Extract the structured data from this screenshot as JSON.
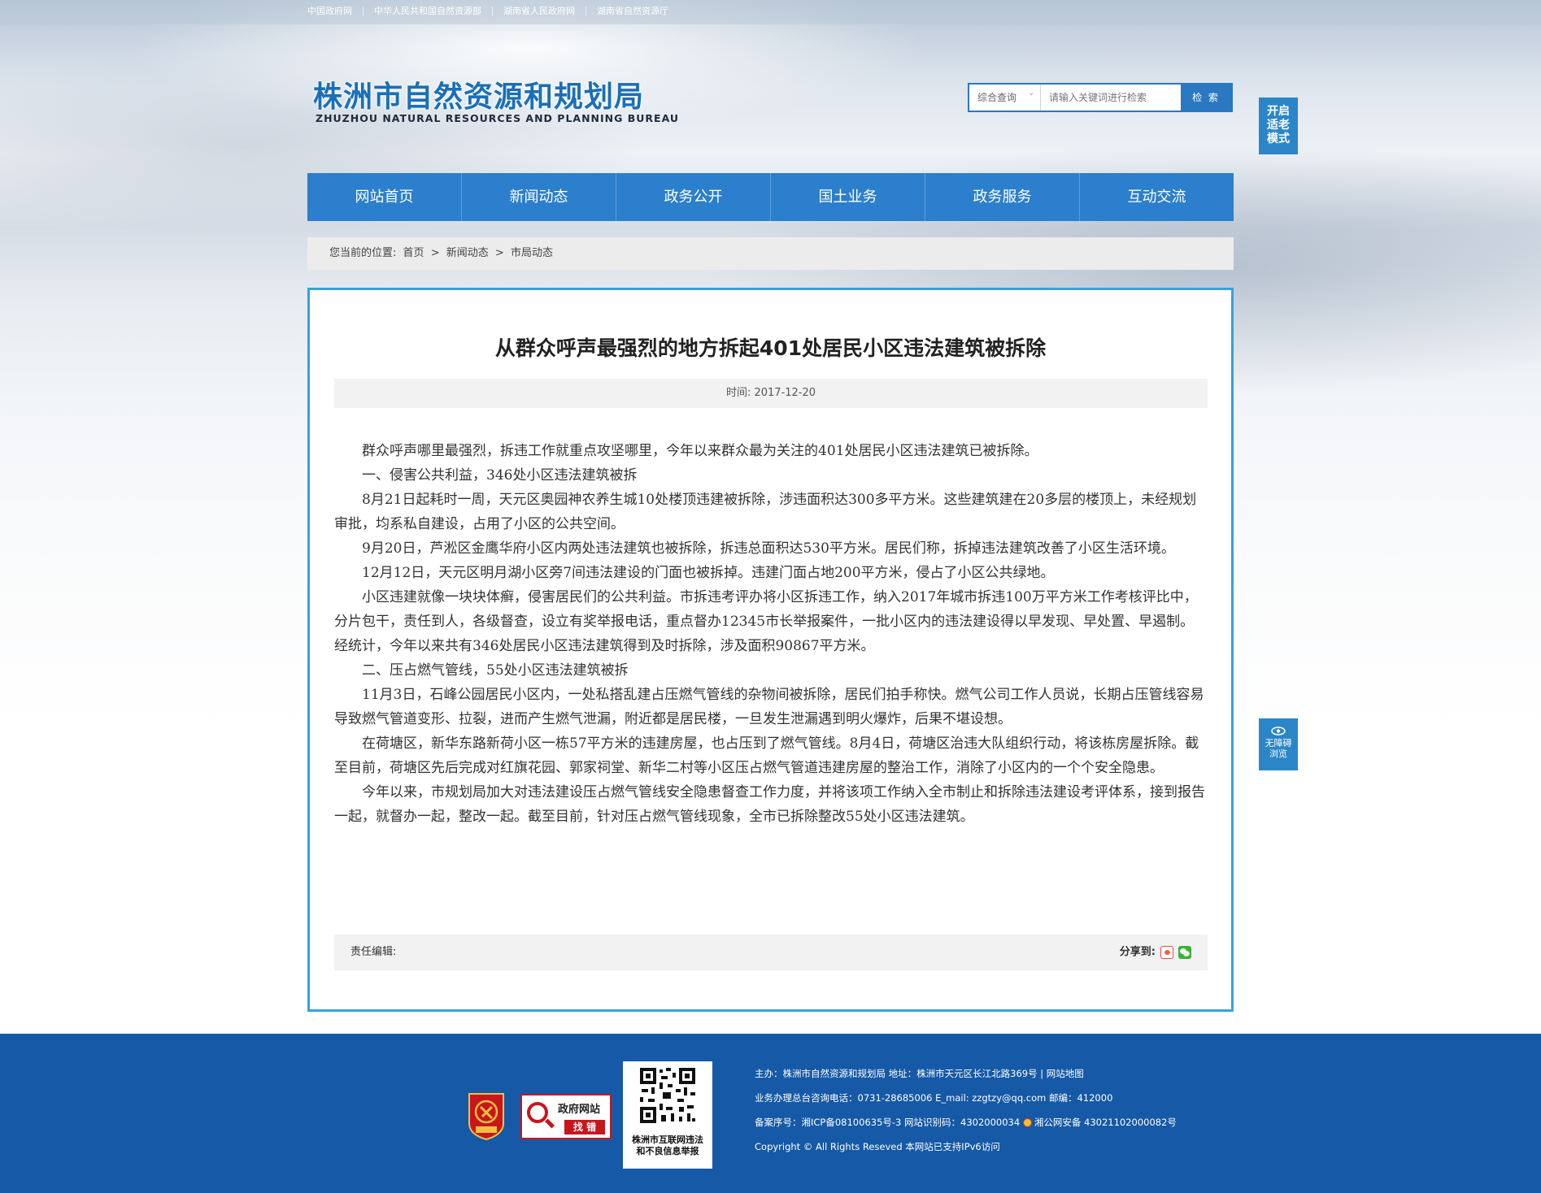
{
  "top_links": [
    "中国政府网",
    "中华人民共和国自然资源部",
    "湖南省人民政府网",
    "湖南省自然资源厅"
  ],
  "logo": {
    "cn": "株洲市自然资源和规划局",
    "en": "ZHUZHOU NATURAL RESOURCES AND PLANNING BUREAU"
  },
  "search": {
    "scope": "综合查询",
    "placeholder": "请输入关键词进行检索",
    "button": "检 索"
  },
  "side": {
    "elder_mode": [
      "开启",
      "适老",
      "模式"
    ],
    "barrier_free": [
      "无障碍",
      "浏览"
    ]
  },
  "nav": [
    "网站首页",
    "新闻动态",
    "政务公开",
    "国土业务",
    "政务服务",
    "互动交流"
  ],
  "breadcrumb": {
    "label": "您当前的位置:",
    "items": [
      "首页",
      ">",
      "新闻动态",
      ">",
      "市局动态"
    ]
  },
  "article": {
    "title": "从群众呼声最强烈的地方拆起401处居民小区违法建筑被拆除",
    "date": "时间: 2017-12-20",
    "paragraphs": [
      "群众呼声哪里最强烈，拆违工作就重点攻坚哪里，今年以来群众最为关注的401处居民小区违法建筑已被拆除。",
      "一、侵害公共利益，346处小区违法建筑被拆",
      "8月21日起耗时一周，天元区奥园神农养生城10处楼顶违建被拆除，涉违面积达300多平方米。这些建筑建在20多层的楼顶上，未经规划审批，均系私自建设，占用了小区的公共空间。",
      "9月20日，芦淞区金鹰华府小区内两处违法建筑也被拆除，拆违总面积达530平方米。居民们称，拆掉违法建筑改善了小区生活环境。",
      "12月12日，天元区明月湖小区旁7间违法建设的门面也被拆掉。违建门面占地200平方米，侵占了小区公共绿地。",
      "小区违建就像一块块体癣，侵害居民们的公共利益。市拆违考评办将小区拆违工作，纳入2017年城市拆违100万平方米工作考核评比中，分片包干，责任到人，各级督查，设立有奖举报电话，重点督办12345市长举报案件，一批小区内的违法建设得以早发现、早处置、早遏制。经统计，今年以来共有346处居民小区违法建筑得到及时拆除，涉及面积90867平方米。",
      "二、压占燃气管线，55处小区违法建筑被拆",
      "11月3日，石峰公园居民小区内，一处私搭乱建占压燃气管线的杂物间被拆除，居民们拍手称快。燃气公司工作人员说，长期占压管线容易导致燃气管道变形、拉裂，进而产生燃气泄漏，附近都是居民楼，一旦发生泄漏遇到明火爆炸，后果不堪设想。",
      "在荷塘区，新华东路新荷小区一栋57平方米的违建房屋，也占压到了燃气管线。8月4日，荷塘区治违大队组织行动，将该栋房屋拆除。截至目前，荷塘区先后完成对红旗花园、郭家祠堂、新华二村等小区压占燃气管道违建房屋的整治工作，消除了小区内的一个个安全隐患。",
      "今年以来，市规划局加大对违法建设压占燃气管线安全隐患督查工作力度，并将该项工作纳入全市制止和拆除违法建设考评体系，接到报告一起，就督办一起，整改一起。截至目前，针对压占燃气管线现象，全市已拆除整改55处小区违法建筑。"
    ],
    "editor_label": "责任编辑:",
    "share_label": "分享到:"
  },
  "footer": {
    "qr_caption": [
      "株洲市互联网违法",
      "和不良信息举报"
    ],
    "gov_badge": {
      "line1": "政府网站",
      "line2": "找 错"
    },
    "lines": [
      "主办：株洲市自然资源和规划局   地址：株洲市天元区长江北路369号  |  网站地图",
      "业务办理总台咨询电话：0731-28685006    E_mail:   zzgtzy@qq.com     邮编：412000",
      "备案序号：湘ICP备08100635号-3  网站识别码：4302000034",
      "Copyright © All Rights Reseved 本网站已支持IPv6访问"
    ],
    "police_record": "湘公网安备 43021102000082号"
  },
  "colors": {
    "nav_blue": "#2b7fcc",
    "panel_border": "#36a3d9",
    "footer_blue": "#1559a7"
  },
  "icons": [
    "chevron-down-icon",
    "eye-icon",
    "weibo-icon",
    "wechat-icon",
    "police-badge-icon",
    "magnifier-icon",
    "qr-code-icon",
    "party-emblem-icon"
  ]
}
